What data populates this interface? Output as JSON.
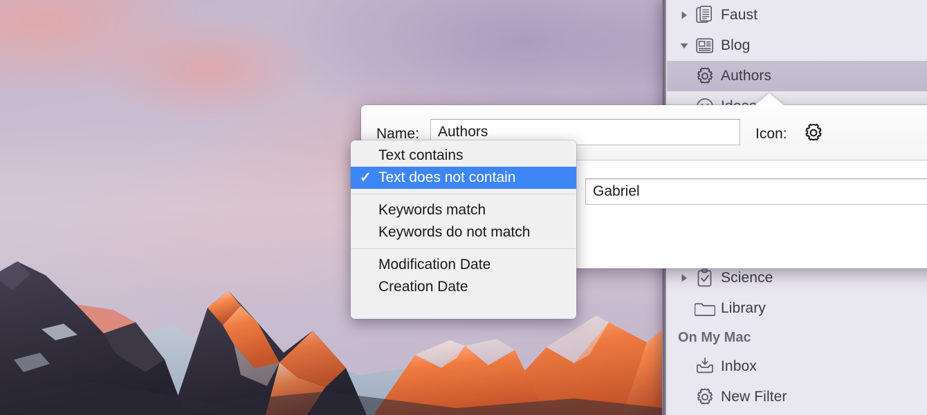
{
  "desktop": {
    "wallpaper_name": "alpenglow-mountain-wallpaper",
    "sky_colors": [
      "#c4b6cb",
      "#cdc0d2",
      "#bfb2c8"
    ],
    "rock_color": "#3a3744",
    "alpenglow_color": "#e8643a",
    "snow_color": "#f3dcd3"
  },
  "sidebar": {
    "items": [
      {
        "label": "Faust",
        "icon": "documents-icon",
        "twisty": "collapsed",
        "indent": 0,
        "selected": false
      },
      {
        "label": "Blog",
        "icon": "newspaper-icon",
        "twisty": "expanded",
        "indent": 0,
        "selected": false
      },
      {
        "label": "Authors",
        "icon": "gear-icon",
        "twisty": "none",
        "indent": 1,
        "selected": true
      },
      {
        "label": "Science",
        "icon": "clipboard-check-icon",
        "twisty": "collapsed",
        "indent": 0,
        "selected": false
      },
      {
        "label": "Library",
        "icon": "folder-icon",
        "twisty": "none",
        "indent": 0,
        "selected": false
      }
    ],
    "group_header": "On My Mac",
    "mac_items": [
      {
        "label": "Inbox",
        "icon": "inbox-icon",
        "twisty": "none"
      },
      {
        "label": "New Filter",
        "icon": "gear-icon",
        "twisty": "none"
      }
    ],
    "selection_color": "#c2bcd0"
  },
  "popover": {
    "name_label": "Name:",
    "name_value": "Authors",
    "name_placeholder": "Name",
    "icon_label": "Icon:",
    "icon_glyph": "gear-icon",
    "value_field": "Gabriel",
    "value_placeholder": "Text",
    "condition_selected": "Text does not contain"
  },
  "menu": {
    "checkmark": "✓",
    "highlight_color": "#3e86f5",
    "groups": [
      {
        "items": [
          {
            "label": "Text contains",
            "checked": false
          },
          {
            "label": "Text does not contain",
            "checked": true
          }
        ]
      },
      {
        "items": [
          {
            "label": "Keywords match",
            "checked": false
          },
          {
            "label": "Keywords do not match",
            "checked": false
          }
        ]
      },
      {
        "items": [
          {
            "label": "Modification Date",
            "checked": false
          },
          {
            "label": "Creation Date",
            "checked": false
          }
        ]
      }
    ]
  }
}
